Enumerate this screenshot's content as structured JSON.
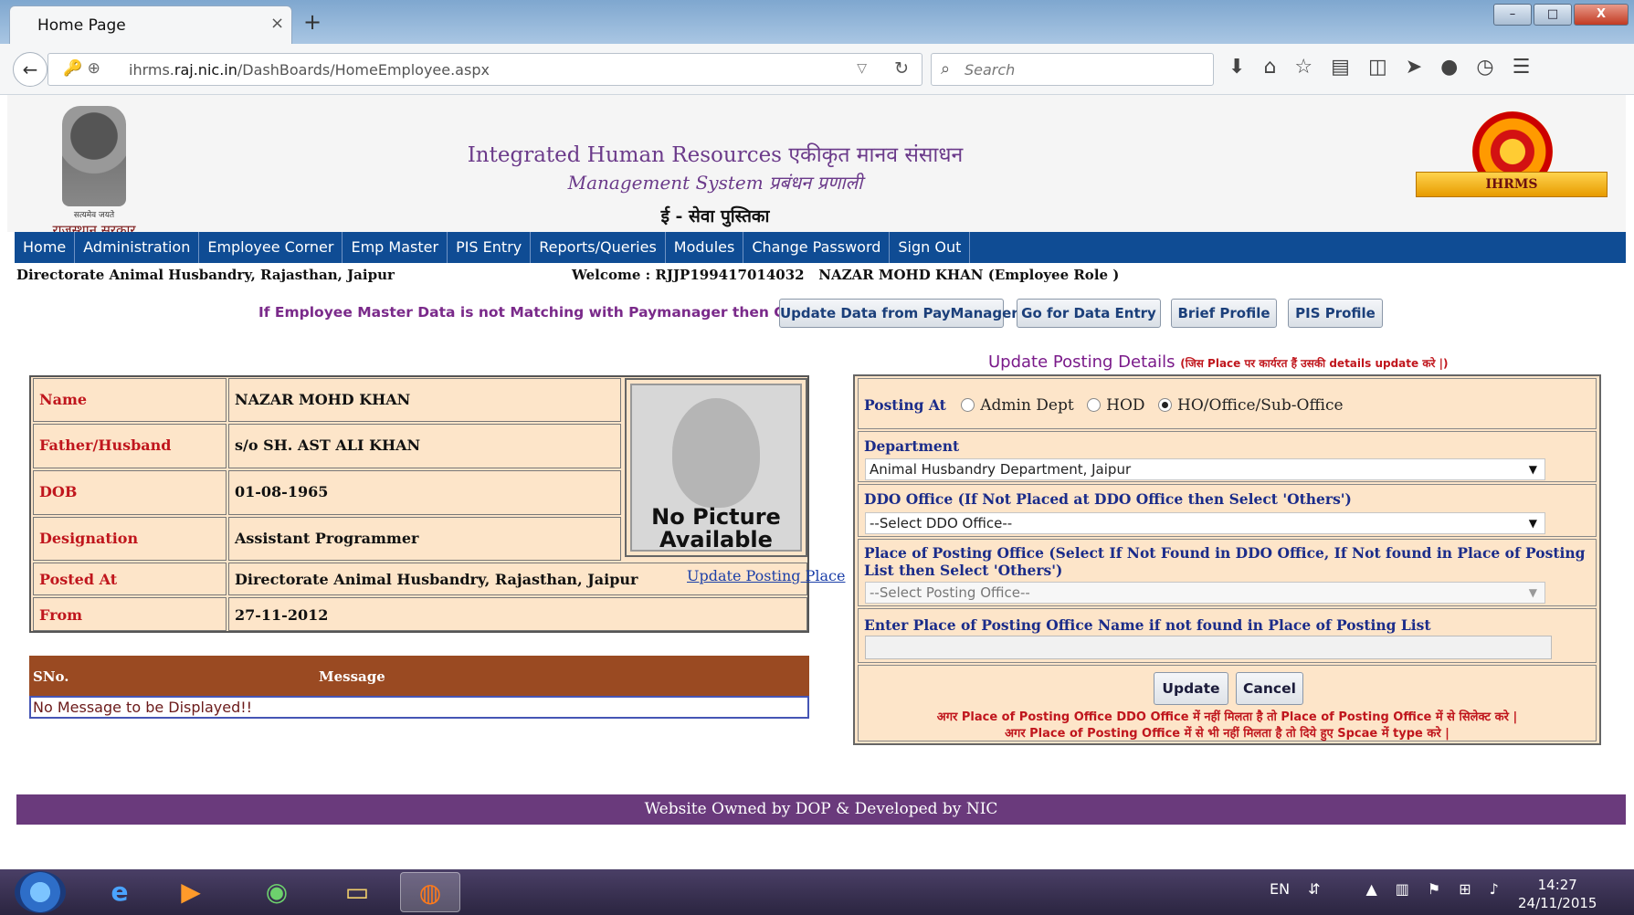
{
  "browser": {
    "tab_title": "Home Page",
    "tab_close": "×",
    "new_tab": "+",
    "url_prefix": "ihrms.",
    "url_domain": "raj.nic.in",
    "url_path": "/DashBoards/HomeEmployee.aspx",
    "search_placeholder": "Search",
    "window_controls": [
      "–",
      "□",
      "X"
    ],
    "toolbar_icons": [
      "download-icon",
      "home-icon",
      "bookmark-star-icon",
      "reading-list-icon",
      "pocket-icon",
      "send-icon",
      "chat-icon",
      "history-icon",
      "menu-icon"
    ]
  },
  "header": {
    "emblem_motto": "सत्यमेव जयते",
    "emblem_caption": "राजस्थान सरकार",
    "brand_line1_en": "Integrated Human Resources",
    "brand_line1_hi": "एकीकृत मानव संसाधन",
    "brand_line2_en": "Management System",
    "brand_line2_hi": "प्रबंधन प्रणाली",
    "brand_line3": "ई - सेवा पुस्तिका",
    "logo_text": "IHRMS"
  },
  "menu": [
    "Home",
    "Administration",
    "Employee Corner",
    "Emp Master",
    "PIS Entry",
    "Reports/Queries",
    "Modules",
    "Change Password",
    "Sign Out"
  ],
  "info": {
    "office": "Directorate Animal Husbandry, Rajasthan, Jaipur",
    "welcome": "Welcome : RJJP199417014032   NAZAR MOHD KHAN (Employee Role )"
  },
  "actions": {
    "notice": "If Employee Master Data is not Matching with Paymanager then Click on:",
    "buttons": [
      "Update Data from PayManager",
      "Go for Data Entry",
      "Brief Profile",
      "PIS Profile"
    ]
  },
  "profile": {
    "rows": [
      {
        "label": "Name",
        "value": "NAZAR MOHD KHAN"
      },
      {
        "label": "Father/Husband",
        "value": "s/o SH. AST ALI KHAN"
      },
      {
        "label": "DOB",
        "value": "01-08-1965"
      },
      {
        "label": "Designation",
        "value": "Assistant Programmer"
      },
      {
        "label": "Posted At",
        "value": "Directorate Animal Husbandry, Rajasthan, Jaipur"
      },
      {
        "label": "From",
        "value": "27-11-2012"
      }
    ],
    "photo_text_line1": "No Picture",
    "photo_text_line2": "Available",
    "update_place_link": "Update Posting Place"
  },
  "messages": {
    "col_sno": "SNo.",
    "col_message": "Message",
    "empty_text": "No Message to be Displayed!!"
  },
  "posting": {
    "title": "Update Posting Details",
    "title_note": "(जिस Place पर कार्यरत हैं उसकी details update करे |)",
    "posting_at_label": "Posting At",
    "radio_options": [
      "Admin Dept",
      "HOD",
      "HO/Office/Sub-Office"
    ],
    "radio_selected": "HO/Office/Sub-Office",
    "department_label": "Department",
    "department_value": "Animal Husbandry Department, Jaipur",
    "ddo_label": "DDO Office (If Not Placed at DDO Office then Select 'Others')",
    "ddo_value": "--Select DDO Office--",
    "place_label": "Place of Posting Office (Select If Not Found in DDO Office, If Not found in Place of Posting List then Select 'Others')",
    "place_value": "--Select Posting Office--",
    "enter_label": "Enter Place of Posting Office Name if not found in Place of Posting List",
    "enter_value": "",
    "update_button": "Update",
    "cancel_button": "Cancel",
    "note1": "अगर Place of Posting Office DDO Office में नहीं मिलता है तो Place of Posting Office में से सिलेक्ट करे |",
    "note2": "अगर Place of Posting Office में से भी नहीं मिलता है तो दिये हुए Spcae में type करे |"
  },
  "footer": "Website Owned by DOP & Developed by NIC",
  "taskbar": {
    "apps": [
      "ie-icon",
      "media-player-icon",
      "chrome-like-icon",
      "file-explorer-icon",
      "firefox-icon"
    ],
    "language": "EN",
    "time": "14:27",
    "date": "24/11/2015"
  },
  "colors": {
    "menu_bg": "#0f4c94",
    "footer_bg": "#6a3a7c",
    "label_red": "#c0161d",
    "panel_bg": "#fde5c9",
    "message_header_bg": "#9a4a22"
  }
}
